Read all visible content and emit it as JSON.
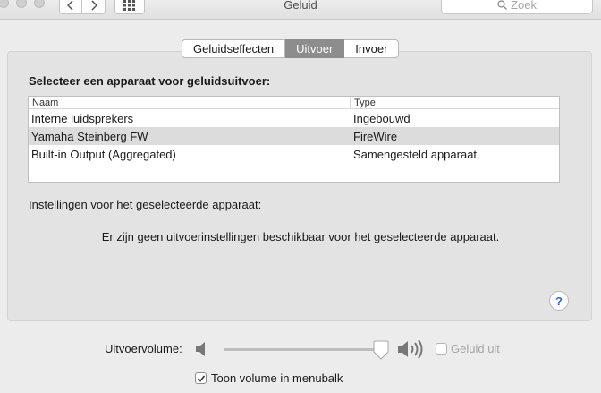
{
  "window": {
    "title": "Geluid",
    "search_placeholder": "Zoek"
  },
  "tabs": [
    {
      "label": "Geluidseffecten",
      "active": false
    },
    {
      "label": "Uitvoer",
      "active": true
    },
    {
      "label": "Invoer",
      "active": false
    }
  ],
  "output": {
    "heading": "Selecteer een apparaat voor geluidsuitvoer:",
    "columns": [
      "Naam",
      "Type"
    ],
    "devices": [
      {
        "name": "Interne luidsprekers",
        "type": "Ingebouwd",
        "selected": false
      },
      {
        "name": "Yamaha Steinberg FW",
        "type": "FireWire",
        "selected": true
      },
      {
        "name": "Built-in Output (Aggregated)",
        "type": "Samengesteld apparaat",
        "selected": false
      }
    ],
    "settings_label": "Instellingen voor het geselecteerde apparaat:",
    "no_settings_text": "Er zijn geen uitvoerinstellingen beschikbaar voor het geselecteerde apparaat.",
    "help_label": "?"
  },
  "volume": {
    "label": "Uitvoervolume:",
    "level": 0.98,
    "mute_label": "Geluid uit",
    "mute_checked": false
  },
  "menubar": {
    "label": "Toon volume in menubalk",
    "checked": true
  },
  "colors": {
    "active_tab": "#8d8d8d",
    "help_accent": "#2a6cd6"
  }
}
